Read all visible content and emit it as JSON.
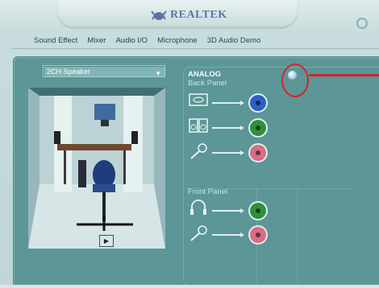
{
  "brand": {
    "name": "REALTEK"
  },
  "tabs": [
    {
      "label": "Sound Effect"
    },
    {
      "label": "Mixer"
    },
    {
      "label": "Audio I/O"
    },
    {
      "label": "Microphone"
    },
    {
      "label": "3D Audio Demo"
    }
  ],
  "speaker_select": {
    "value": "2CH Speaker"
  },
  "analog": {
    "heading": "ANALOG",
    "back_panel": "Back Panel",
    "front_panel": "Front Panel"
  },
  "jacks": {
    "back": [
      {
        "device": "line-in-icon",
        "color": "#2c5fc4"
      },
      {
        "device": "speaker-out-icon",
        "color": "#2f8f3a"
      },
      {
        "device": "microphone-icon",
        "color": "#d96b86"
      }
    ],
    "front": [
      {
        "device": "headphone-icon",
        "color": "#2f8f3a"
      },
      {
        "device": "microphone-icon",
        "color": "#d96b86"
      }
    ]
  },
  "colors": {
    "annotation": "#d3252a",
    "panel": "#5c9696"
  }
}
